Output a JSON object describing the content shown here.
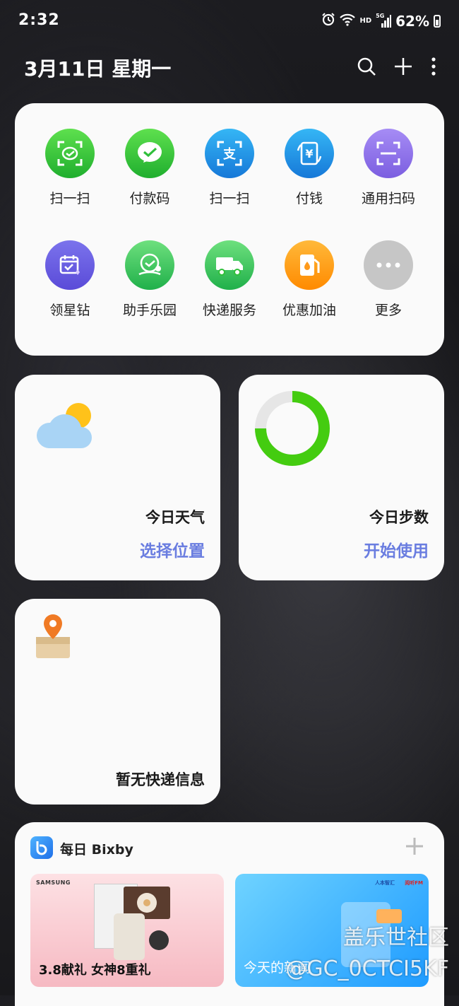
{
  "status_bar": {
    "time": "2:32",
    "network": "HD",
    "signal_label": "5G",
    "battery": "62%"
  },
  "header": {
    "date": "3月11日 星期一"
  },
  "apps": [
    {
      "label": "扫一扫",
      "icon": "wechat-scan-icon",
      "color": "#2fbf3a"
    },
    {
      "label": "付款码",
      "icon": "wechat-pay-icon",
      "color": "#2fbf3a"
    },
    {
      "label": "扫一扫",
      "icon": "alipay-scan-icon",
      "color": "#1a8fe0"
    },
    {
      "label": "付钱",
      "icon": "alipay-pay-icon",
      "color": "#1a8fe0"
    },
    {
      "label": "通用扫码",
      "icon": "universal-scan-icon",
      "color": "#8a6ae6"
    },
    {
      "label": "领星钻",
      "icon": "star-diamond-icon",
      "color": "#6a5ae0"
    },
    {
      "label": "助手乐园",
      "icon": "assistant-park-icon",
      "color": "#3cc05a"
    },
    {
      "label": "快递服务",
      "icon": "delivery-truck-icon",
      "color": "#3cc05a"
    },
    {
      "label": "优惠加油",
      "icon": "fuel-pump-icon",
      "color": "#ff9a1a"
    },
    {
      "label": "更多",
      "icon": "more-icon",
      "color": "#c8c8c8"
    }
  ],
  "weather": {
    "title": "今日天气",
    "action": "选择位置"
  },
  "steps": {
    "title": "今日步数",
    "action": "开始使用"
  },
  "delivery": {
    "title": "暂无快递信息"
  },
  "bixby": {
    "title": "每日 Bixby",
    "banners": [
      {
        "brand": "SAMSUNG",
        "caption": "3.8献礼 女神8重礼"
      },
      {
        "caption": "今天的新闻",
        "logo1": "人本智汇",
        "logo2": "阅听FM"
      }
    ]
  },
  "watermark": {
    "line1": "盖乐世社区",
    "line2": "@GC_0CTCI5KF"
  }
}
